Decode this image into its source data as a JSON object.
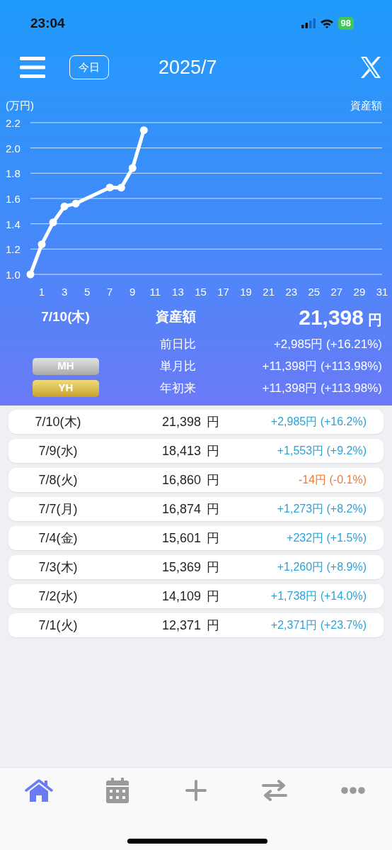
{
  "status_bar": {
    "time": "23:04",
    "battery": "98"
  },
  "header": {
    "today_button": "今日",
    "title": "2025/7"
  },
  "chart": {
    "chart_data": {
      "type": "line",
      "ylabel": "(万円)",
      "x": [
        0,
        1,
        2,
        3,
        4,
        7,
        8,
        9,
        10
      ],
      "series": [
        {
          "name": "資産額",
          "color": "#ffffff",
          "marker": "circle",
          "values": [
            1.0,
            1.237,
            1.411,
            1.537,
            1.56,
            1.687,
            1.686,
            1.841,
            2.14
          ]
        }
      ],
      "xlim": [
        0,
        31
      ],
      "ylim": [
        1.0,
        2.2
      ],
      "xticks": [
        1,
        3,
        5,
        7,
        9,
        11,
        13,
        15,
        17,
        19,
        21,
        23,
        25,
        27,
        29,
        31
      ],
      "yticks": [
        {
          "value": 1,
          "label": "1.0"
        },
        {
          "value": 1.2,
          "label": "1.2"
        },
        {
          "value": 1.4,
          "label": "1.4"
        },
        {
          "value": 1.6,
          "label": "1.6"
        },
        {
          "value": 1.8,
          "label": "1.8"
        },
        {
          "value": 2,
          "label": "2.0"
        },
        {
          "value": 2.2,
          "label": "2.2"
        }
      ],
      "grid": true
    }
  },
  "summary": {
    "date": "7/10(木)",
    "label": "資産額",
    "amount": "21,398",
    "unit": "円",
    "rows": [
      {
        "label": "前日比",
        "value": "+2,985円 (+16.21%)"
      },
      {
        "label": "単月比",
        "value": "+11,398円 (+113.98%)"
      },
      {
        "label": "年初来",
        "value": "+11,398円 (+113.98%)"
      }
    ],
    "badges": [
      {
        "text": "MH",
        "kind": "silver"
      },
      {
        "text": "YH",
        "kind": "gold"
      }
    ]
  },
  "history": [
    {
      "date": "7/10(木)",
      "amount": "21,398",
      "unit": "円",
      "change": "+2,985円 (+16.2%)",
      "kind": "up"
    },
    {
      "date": "7/9(水)",
      "amount": "18,413",
      "unit": "円",
      "change": "+1,553円 (+9.2%)",
      "kind": "up"
    },
    {
      "date": "7/8(火)",
      "amount": "16,860",
      "unit": "円",
      "change": "-14円 (-0.1%)",
      "kind": "down"
    },
    {
      "date": "7/7(月)",
      "amount": "16,874",
      "unit": "円",
      "change": "+1,273円 (+8.2%)",
      "kind": "up"
    },
    {
      "date": "7/4(金)",
      "amount": "15,601",
      "unit": "円",
      "change": "+232円 (+1.5%)",
      "kind": "up"
    },
    {
      "date": "7/3(木)",
      "amount": "15,369",
      "unit": "円",
      "change": "+1,260円 (+8.9%)",
      "kind": "up"
    },
    {
      "date": "7/2(水)",
      "amount": "14,109",
      "unit": "円",
      "change": "+1,738円 (+14.0%)",
      "kind": "up"
    },
    {
      "date": "7/1(火)",
      "amount": "12,371",
      "unit": "円",
      "change": "+2,371円 (+23.7%)",
      "kind": "up"
    }
  ],
  "tab_bar": [
    {
      "kind": "home",
      "selected": true
    },
    {
      "kind": "calendar",
      "selected": false
    },
    {
      "kind": "plus",
      "selected": false
    },
    {
      "kind": "transfer",
      "selected": false
    },
    {
      "kind": "more",
      "selected": false
    }
  ]
}
